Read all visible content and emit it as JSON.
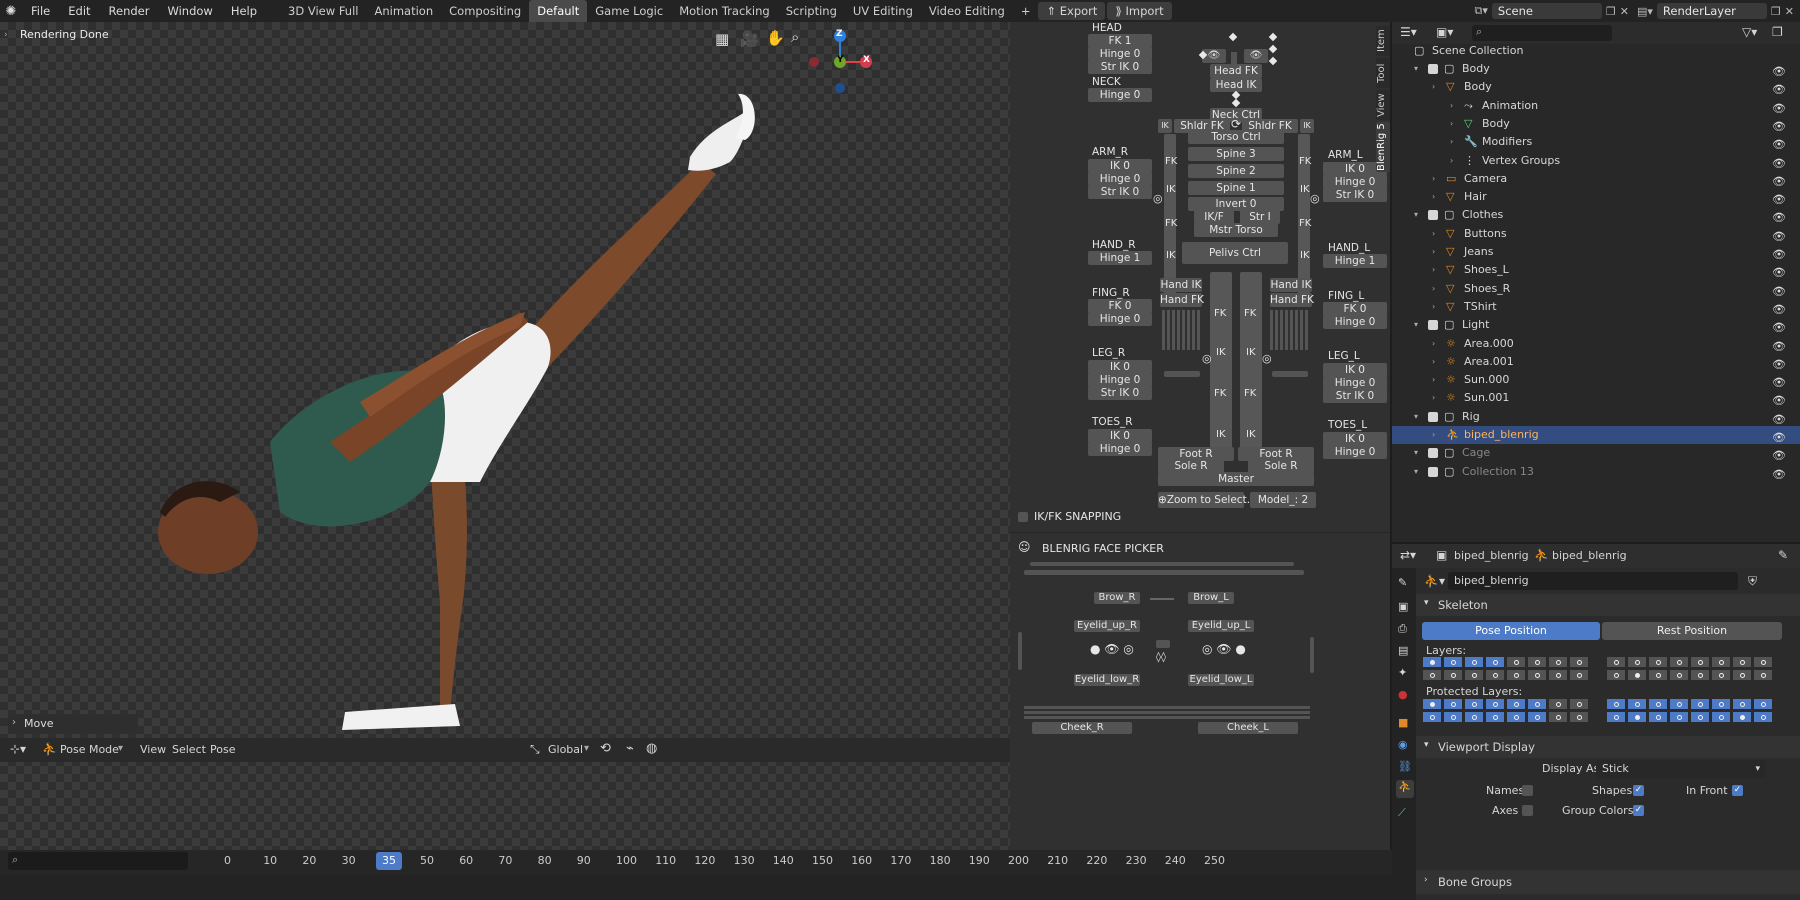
{
  "menu": [
    "File",
    "Edit",
    "Render",
    "Window",
    "Help"
  ],
  "workspaces": [
    "3D View Full",
    "Animation",
    "Compositing",
    "Default",
    "Game Logic",
    "Motion Tracking",
    "Scripting",
    "UV Editing",
    "Video Editing"
  ],
  "active_workspace": "Default",
  "add_tab": "+",
  "export_label": "Export",
  "import_label": "Import",
  "scene_name": "Scene",
  "render_layer": "RenderLayer",
  "viewport": {
    "status": "Rendering Done",
    "operator": "Move",
    "axis_x": "X",
    "axis_y": "Y",
    "axis_z": "Z"
  },
  "header3d": {
    "mode": "Pose Mode",
    "menus": [
      "View",
      "Select",
      "Pose"
    ],
    "orientation": "Global"
  },
  "rig": {
    "head": "HEAD",
    "fk1": "FK 1",
    "hinge0": "Hinge 0",
    "strik0": "Str IK 0",
    "neck": "NECK",
    "arm_r": "ARM_R",
    "arm_l": "ARM_L",
    "ik0": "IK 0",
    "hand_r": "HAND_R",
    "hand_l": "HAND_L",
    "hinge1": "Hinge 1",
    "fing_r": "FING_R",
    "fing_l": "FING_L",
    "fk0": "FK 0",
    "leg_r": "LEG_R",
    "leg_l": "LEG_L",
    "toes_r": "TOES_R",
    "toes_l": "TOES_L",
    "head_fk": "Head FK",
    "head_ik": "Head IK",
    "neck_ctrl": "Neck Ctrl",
    "shldr_fk": "Shldr FK",
    "torso_ctrl": "Torso Ctrl",
    "spine3": "Spine 3",
    "spine2": "Spine 2",
    "spine1": "Spine 1",
    "invert": "Invert 0",
    "ikf": "IK/F",
    "stri": "Str I",
    "mstr_torso": "Mstr Torso",
    "pelvis": "Pelivs Ctrl",
    "hand_ik": "Hand IK",
    "hand_fk": "Hand FK",
    "fk": "FK",
    "ik": "IK",
    "foot_r": "Foot R",
    "sole_r": "Sole R",
    "master": "Master",
    "zoom": "Zoom to Select..",
    "model": "Model_:  2",
    "snapping": "IK/FK SNAPPING",
    "face_picker": "BLENRIG FACE PICKER",
    "brow_r": "Brow_R",
    "brow_l": "Brow_L",
    "eyelid_up_r": "Eyelid_up_R",
    "eyelid_up_l": "Eyelid_up_L",
    "eyelid_low_r": "Eyelid_low_R",
    "eyelid_low_l": "Eyelid_low_L",
    "cheek_r": "Cheek_R",
    "cheek_l": "Cheek_L"
  },
  "side_tabs": [
    "Item",
    "Tool",
    "View",
    "BlenRig 5"
  ],
  "outliner": {
    "root": "Scene Collection",
    "rows": [
      {
        "label": "Body",
        "indent": 1,
        "type": "collection"
      },
      {
        "label": "Body",
        "indent": 2,
        "type": "mesh-obj"
      },
      {
        "label": "Animation",
        "indent": 3,
        "type": "anim"
      },
      {
        "label": "Body",
        "indent": 3,
        "type": "mesh"
      },
      {
        "label": "Modifiers",
        "indent": 3,
        "type": "wrench"
      },
      {
        "label": "Vertex Groups",
        "indent": 3,
        "type": "vgroup"
      },
      {
        "label": "Camera",
        "indent": 2,
        "type": "camera"
      },
      {
        "label": "Hair",
        "indent": 2,
        "type": "mesh-obj"
      },
      {
        "label": "Clothes",
        "indent": 1,
        "type": "collection"
      },
      {
        "label": "Buttons",
        "indent": 2,
        "type": "mesh-obj"
      },
      {
        "label": "Jeans",
        "indent": 2,
        "type": "mesh-obj"
      },
      {
        "label": "Shoes_L",
        "indent": 2,
        "type": "mesh-obj"
      },
      {
        "label": "Shoes_R",
        "indent": 2,
        "type": "mesh-obj"
      },
      {
        "label": "TShirt",
        "indent": 2,
        "type": "mesh-obj"
      },
      {
        "label": "Light",
        "indent": 1,
        "type": "collection"
      },
      {
        "label": "Area.000",
        "indent": 2,
        "type": "light"
      },
      {
        "label": "Area.001",
        "indent": 2,
        "type": "light"
      },
      {
        "label": "Sun.000",
        "indent": 2,
        "type": "light"
      },
      {
        "label": "Sun.001",
        "indent": 2,
        "type": "light"
      },
      {
        "label": "Rig",
        "indent": 1,
        "type": "collection"
      },
      {
        "label": "biped_blenrig",
        "indent": 2,
        "type": "armature",
        "selected": true
      },
      {
        "label": "Cage",
        "indent": 1,
        "type": "collection",
        "dim": true
      },
      {
        "label": "Collection 13",
        "indent": 1,
        "type": "collection",
        "dim": true
      }
    ],
    "badge6": "6"
  },
  "properties": {
    "object": "biped_blenrig",
    "armature": "biped_blenrig",
    "data_name": "biped_blenrig",
    "skeleton": "Skeleton",
    "pose_position": "Pose Position",
    "rest_position": "Rest Position",
    "layers": "Layers:",
    "protected_layers": "Protected Layers:",
    "viewport_display": "Viewport Display",
    "display_as_label": "Display As",
    "display_as": "Stick",
    "names": "Names",
    "shapes": "Shapes",
    "in_front": "In Front",
    "axes": "Axes",
    "group_colors": "Group Colors",
    "bone_groups": "Bone Groups"
  },
  "timeline": {
    "current_frame": "35",
    "ticks": [
      "0",
      "10",
      "20",
      "30",
      "40",
      "50",
      "60",
      "70",
      "80",
      "90",
      "100",
      "110",
      "120",
      "130",
      "140",
      "150",
      "160",
      "170",
      "180",
      "190",
      "200",
      "210",
      "220",
      "230",
      "240",
      "250"
    ]
  }
}
